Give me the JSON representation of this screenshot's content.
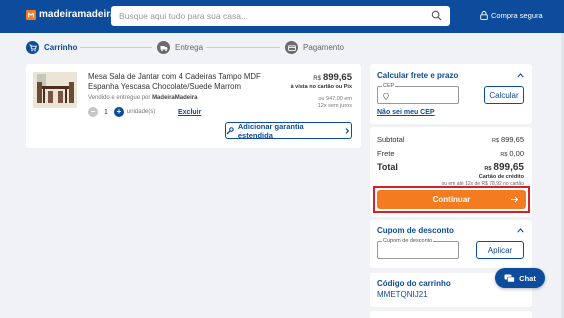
{
  "header": {
    "logo_text": "madeiramadeira",
    "search_placeholder": "Busque aqui tudo para sua casa...",
    "secure_label": "Compra segura"
  },
  "steps": [
    {
      "label": "Carrinho",
      "icon": "cart-icon",
      "active": true
    },
    {
      "label": "Entrega",
      "icon": "truck-icon",
      "active": false
    },
    {
      "label": "Pagamento",
      "icon": "payment-icon",
      "active": false
    }
  ],
  "cart_item": {
    "title": "Mesa Sala de Jantar com 4 Cadeiras Tampo MDF Espanha Yescasa Chocolate/Suede Marrom",
    "sold_prefix": "Vendido e entregue por",
    "seller": "MadeiraMadeira",
    "quantity": "1",
    "quantity_unit": "unidade(s)",
    "remove_label": "Excluir",
    "currency": "R$",
    "price": "899,65",
    "price_note": "à vista no cartão ou Pix",
    "alt_price_line1": "ou 947,00 em",
    "alt_price_line2": "12x sem juros",
    "warranty_label": "Adicionar garantia estendida"
  },
  "shipping": {
    "title": "Calcular frete e prazo",
    "cep_label": "CEP",
    "cep_value": "",
    "calc_button": "Calcular",
    "no_cep_link": "Não sei meu CEP"
  },
  "summary": {
    "subtotal_label": "Subtotal",
    "subtotal_value": "899,65",
    "frete_label": "Frete",
    "frete_value": "0,00",
    "total_label": "Total",
    "currency": "R$",
    "total_value": "899,65",
    "cc_note": "Cartão de crédito",
    "cc_alt": "ou em até 12x de R$ 78,92 no cartão",
    "continue_label": "Continuar"
  },
  "coupon": {
    "title": "Cupom de desconto",
    "field_label": "Cupom de desconto",
    "field_value": "",
    "apply_button": "Aplicar"
  },
  "cart_code": {
    "title": "Código do carrinho",
    "value": "MMETQNIJ21"
  },
  "chat": {
    "label": "Chat"
  },
  "colors": {
    "brand_blue": "#0d4b9c",
    "accent_orange": "#f47b20",
    "highlight_red": "#d6202a"
  }
}
